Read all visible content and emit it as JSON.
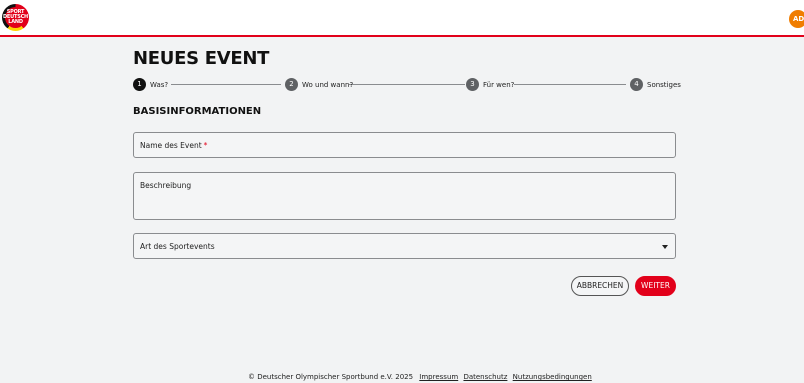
{
  "header": {
    "logo_text": [
      "SPORT",
      "DEUTSCH",
      "LAND"
    ],
    "avatar_initials": "AD",
    "accent_color": "#e2001a"
  },
  "main": {
    "title": "NEUES EVENT",
    "stepper": [
      {
        "number": "1",
        "label": "Was?",
        "active": true
      },
      {
        "number": "2",
        "label": "Wo und wann?",
        "active": false
      },
      {
        "number": "3",
        "label": "Für wen?",
        "active": false
      },
      {
        "number": "4",
        "label": "Sonstiges",
        "active": false
      }
    ],
    "section_title": "BASISINFORMATIONEN",
    "fields": {
      "name_label": "Name des Event",
      "name_required_mark": "*",
      "description_label": "Beschreibung",
      "type_label": "Art des Sportevents"
    },
    "buttons": {
      "cancel": "ABBRECHEN",
      "next": "WEITER"
    }
  },
  "footer": {
    "copyright": "© Deutscher Olympischer Sportbund e.V. 2025",
    "links": [
      "Impressum",
      "Datenschutz",
      "Nutzungsbedingungen"
    ]
  }
}
